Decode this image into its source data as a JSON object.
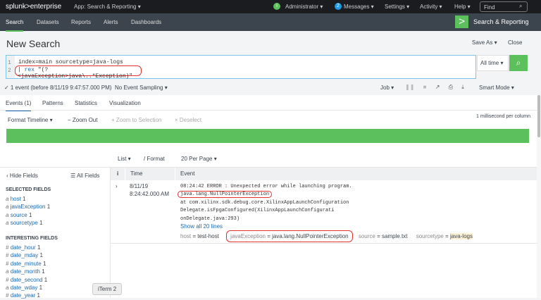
{
  "topbar": {
    "logo": "splunk>enterprise",
    "app": "App: Search & Reporting ▾",
    "user": "Administrator ▾",
    "messages_count": "2",
    "messages": "Messages ▾",
    "settings": "Settings ▾",
    "activity": "Activity ▾",
    "help": "Help ▾",
    "find_placeholder": "Find"
  },
  "appbar": {
    "tabs": [
      "Search",
      "Datasets",
      "Reports",
      "Alerts",
      "Dashboards"
    ],
    "app_title": "Search & Reporting"
  },
  "page": {
    "title": "New Search",
    "save_as": "Save As ▾",
    "close": "Close"
  },
  "search": {
    "line1": "index=main sourcetype=java-logs",
    "line2_pipe": "|",
    "line2_cmd": "rex",
    "line2_rest": " \"(?<javaException>java\\..*Exception)\"",
    "time_range": "All time ▾"
  },
  "status": {
    "summary": "✓ 1 event (before 8/11/19 9:47:57.000 PM)",
    "sampling": "No Event Sampling ▾",
    "job": "Job ▾",
    "mode": "Smart Mode ▾"
  },
  "tabs": [
    "Events (1)",
    "Patterns",
    "Statistics",
    "Visualization"
  ],
  "timeline": {
    "format": "Format Timeline ▾",
    "zoom_out": "− Zoom Out",
    "zoom_sel": "+ Zoom to Selection",
    "deselect": "× Deselect",
    "scale": "1 millisecond per column"
  },
  "results_bar": {
    "list": "List ▾",
    "format": "/ Format",
    "per_page": "20 Per Page ▾"
  },
  "sidebar": {
    "hide": "‹ Hide Fields",
    "all": "☰ All Fields",
    "selected_title": "SELECTED FIELDS",
    "selected": [
      {
        "t": "a",
        "n": "host",
        "c": "1"
      },
      {
        "t": "a",
        "n": "javaException",
        "c": "1"
      },
      {
        "t": "a",
        "n": "source",
        "c": "1"
      },
      {
        "t": "a",
        "n": "sourcetype",
        "c": "1"
      }
    ],
    "interesting_title": "INTERESTING FIELDS",
    "interesting": [
      {
        "t": "#",
        "n": "date_hour",
        "c": "1"
      },
      {
        "t": "#",
        "n": "date_mday",
        "c": "1"
      },
      {
        "t": "#",
        "n": "date_minute",
        "c": "1"
      },
      {
        "t": "a",
        "n": "date_month",
        "c": "1"
      },
      {
        "t": "#",
        "n": "date_second",
        "c": "1"
      },
      {
        "t": "a",
        "n": "date_wday",
        "c": "1"
      },
      {
        "t": "#",
        "n": "date_year",
        "c": "1"
      }
    ]
  },
  "table": {
    "col_i": "i",
    "col_time": "Time",
    "col_event": "Event",
    "row": {
      "date": "8/11/19",
      "time": "8:24:42.000 AM",
      "lines": [
        "08:24:42 ERROR : Unexpected error while launching program.",
        "java.lang.NullPointerException",
        "at com.xilinx.sdk.debug.core.XilinxAppLaunchConfiguration",
        "Delegate.isFpgaConfigured(XilinxAppLaunchConfigurati",
        "onDelegate.java:293)"
      ],
      "show_all": "Show all 20 lines",
      "fields": [
        {
          "k": "host",
          "v": "test-host"
        },
        {
          "k": "javaException",
          "v": "java.lang.NullPointerException"
        },
        {
          "k": "source",
          "v": "sample.txt"
        },
        {
          "k": "sourcetype",
          "v": "java-logs"
        }
      ]
    }
  },
  "tooltip": "iTerm 2"
}
